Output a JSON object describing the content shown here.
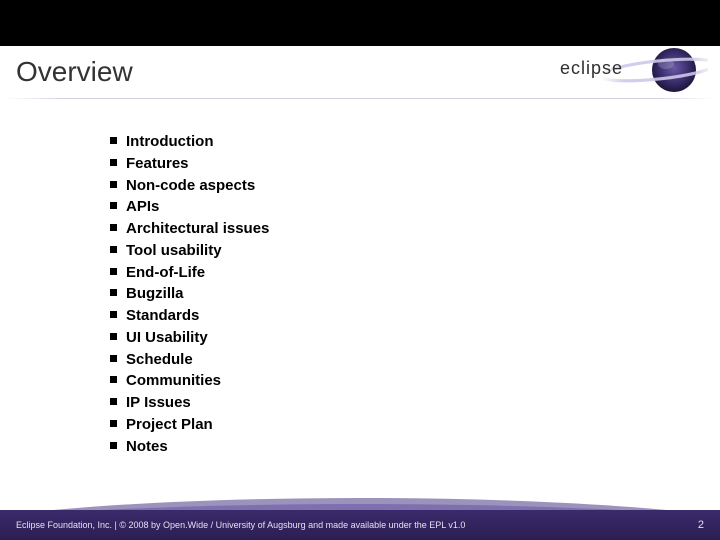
{
  "header": {
    "title": "Overview",
    "logo_text": "eclipse"
  },
  "bullets": [
    "Introduction",
    "Features",
    "Non-code aspects",
    "APIs",
    "Architectural issues",
    "Tool usability",
    "End-of-Life",
    "Bugzilla",
    "Standards",
    "UI Usability",
    "Schedule",
    "Communities",
    "IP Issues",
    "Project Plan",
    "Notes"
  ],
  "footer": {
    "text": "Eclipse Foundation, Inc. | © 2008 by Open.Wide / University of Augsburg and made available under the EPL v1.0",
    "page_number": "2"
  }
}
